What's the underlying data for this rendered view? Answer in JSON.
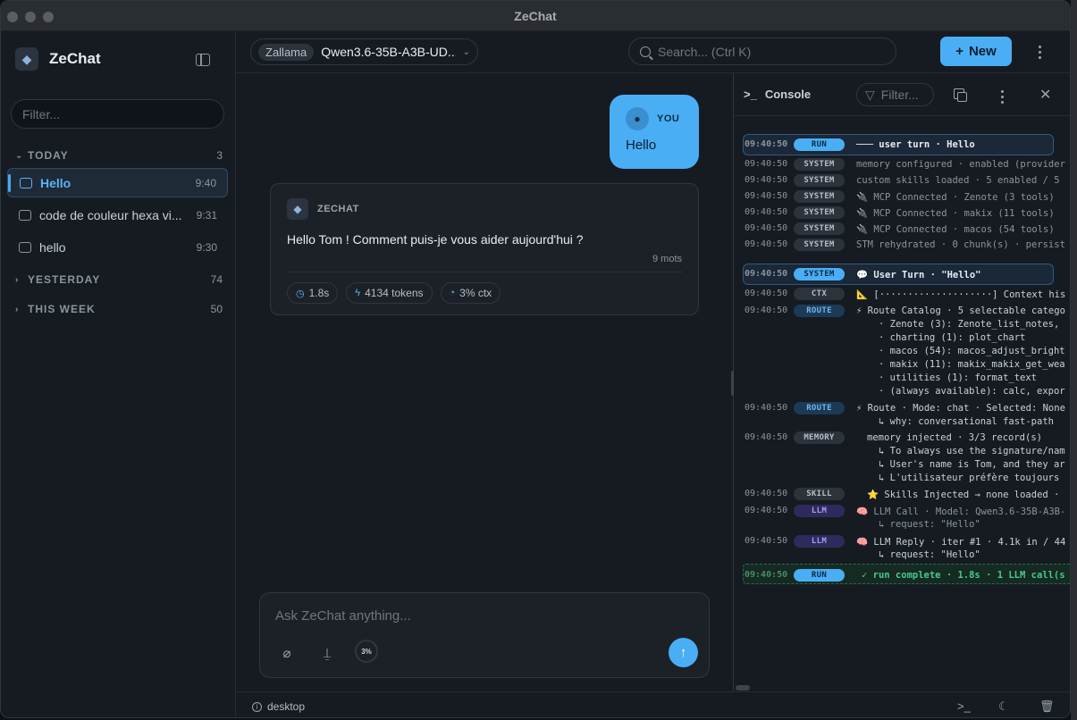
{
  "window": {
    "title": "ZeChat"
  },
  "sidebar": {
    "brand": "ZeChat",
    "filter_placeholder": "Filter...",
    "groups": [
      {
        "label": "TODAY",
        "count": "3"
      },
      {
        "label": "YESTERDAY",
        "count": "74"
      },
      {
        "label": "THIS WEEK",
        "count": "50"
      }
    ],
    "chats": [
      {
        "label": "Hello",
        "time": "9:40"
      },
      {
        "label": "code de couleur hexa vi...",
        "time": "9:31"
      },
      {
        "label": "hello",
        "time": "9:30"
      }
    ]
  },
  "header": {
    "provider": "Zallama",
    "model": "Qwen3.6-35B-A3B-UD...",
    "search_placeholder": "Search...  (Ctrl K)",
    "new_label": "New"
  },
  "conversation": {
    "user": {
      "role": "YOU",
      "text": "Hello"
    },
    "assistant": {
      "role": "ZECHAT",
      "text": "Hello Tom ! Comment puis-je vous aider aujourd'hui ?",
      "words": "9 mots",
      "stats": {
        "time": "1.8s",
        "tokens": "4134 tokens",
        "ctx": "3% ctx"
      }
    }
  },
  "composer": {
    "placeholder": "Ask ZeChat anything...",
    "ctx_percent": "3%"
  },
  "console": {
    "title": "Console",
    "filter_placeholder": "Filter...",
    "logs": [
      {
        "ts": "09:40:50",
        "tag": "RUN",
        "msg": "─── user turn · Hello"
      },
      {
        "ts": "09:40:50",
        "tag": "SYSTEM",
        "msg": "memory configured · enabled (provider"
      },
      {
        "ts": "09:40:50",
        "tag": "SYSTEM",
        "msg": "custom skills loaded · 5 enabled / 5"
      },
      {
        "ts": "09:40:50",
        "tag": "SYSTEM",
        "msg": "🔌 MCP Connected · Zenote (3 tools)"
      },
      {
        "ts": "09:40:50",
        "tag": "SYSTEM",
        "msg": "🔌 MCP Connected · makix (11 tools)"
      },
      {
        "ts": "09:40:50",
        "tag": "SYSTEM",
        "msg": "🔌 MCP Connected · macos (54 tools)"
      },
      {
        "ts": "09:40:50",
        "tag": "SYSTEM",
        "msg": "STM rehydrated · 0 chunk(s) · persist"
      },
      {
        "ts": "09:40:50",
        "tag": "SYSTEM",
        "msg": "💬 User Turn · \"Hello\""
      },
      {
        "ts": "09:40:50",
        "tag": "CTX",
        "msg": "📐 [····················] Context his"
      },
      {
        "ts": "09:40:50",
        "tag": "ROUTE",
        "msg": "⚡ Route Catalog · 5 selectable catego"
      },
      {
        "ts": "09:40:50",
        "tag": "ROUTE",
        "msg": "⚡ Route · Mode: chat · Selected: None"
      },
      {
        "ts": "09:40:50",
        "tag": "MEMORY",
        "msg": "memory injected · 3/3 record(s)"
      },
      {
        "ts": "09:40:50",
        "tag": "SKILL",
        "msg": "⭐ Skills Injected → none loaded ·"
      },
      {
        "ts": "09:40:50",
        "tag": "LLM",
        "msg": "🧠 LLM Call · Model: Qwen3.6-35B-A3B-"
      },
      {
        "ts": "09:40:50",
        "tag": "LLM",
        "msg": "🧠 LLM Reply · iter #1 · 4.1k in / 44"
      },
      {
        "ts": "09:40:50",
        "tag": "RUN",
        "msg": "✓ run complete · 1.8s · 1 LLM call(s"
      }
    ],
    "route_catalog_lines": [
      "· Zenote (3): Zenote_list_notes,",
      "· charting (1): plot_chart",
      "· macos (54): macos_adjust_bright",
      "· makix (11): makix_makix_get_wea",
      "· utilities (1): format_text",
      "· (always available): calc, expor"
    ],
    "route_why": "↳ why: conversational fast-path",
    "memory_lines": [
      "↳ To always use the signature/nam",
      "↳ User's name is Tom, and they ar",
      "↳ L'utilisateur préfère toujours"
    ],
    "llm_call_sub": "↳ request: \"Hello\"",
    "llm_reply_sub": "↳ request: \"Hello\""
  },
  "footer": {
    "host": "desktop"
  }
}
